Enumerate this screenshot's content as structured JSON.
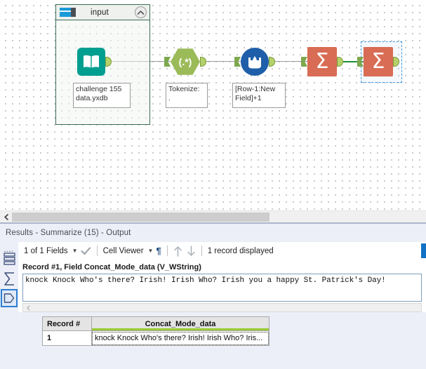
{
  "canvas": {
    "container": {
      "title": "input",
      "icon": "container-icon",
      "collapse_icon": "chevron-up-icon"
    },
    "tools": [
      {
        "name": "input-data-tool",
        "icon": "book-icon",
        "annotation": "challenge 155\ndata.yxdb",
        "annotation_line1": "challenge 155",
        "annotation_line2": "data.yxdb"
      },
      {
        "name": "regex-tool",
        "icon": "regex-icon",
        "glyph": "(.*)",
        "annotation_line1": "Tokenize:",
        "annotation_line2": "."
      },
      {
        "name": "multi-row-formula-tool",
        "icon": "beaker-drop-icon",
        "annotation_line1": "[Row-1:New",
        "annotation_line2": "Field]+1"
      },
      {
        "name": "summarize-tool-1",
        "icon": "sigma-icon",
        "glyph": "Σ"
      },
      {
        "name": "summarize-tool-2",
        "icon": "sigma-icon",
        "glyph": "Σ",
        "selected": true
      }
    ],
    "scrollbar": {
      "left_arrow": "chevron-left-icon"
    }
  },
  "results": {
    "title": "Results - Summarize (15) - Output",
    "rail": {
      "grip": "drag-grip-icon",
      "buttons": [
        {
          "name": "rail-messages-icon",
          "icon": "list-rows-icon"
        },
        {
          "name": "rail-summarize-icon",
          "icon": "sigma-icon"
        },
        {
          "name": "rail-cell-viewer-icon",
          "icon": "cell-tag-icon",
          "active": true
        }
      ]
    },
    "toolbar": {
      "fields_label": "1 of 1 Fields",
      "fields_caret": "chevron-down-icon",
      "check_icon": "checkmark-icon",
      "view_label": "Cell Viewer",
      "view_caret": "chevron-down-icon",
      "pilcrow_icon": "pilcrow-icon",
      "up_icon": "arrow-up-icon",
      "down_icon": "arrow-down-icon",
      "record_count": "1 record displayed"
    },
    "cell_viewer": {
      "header": "Record #1, Field Concat_Mode_data (V_WString)",
      "text": "knock Knock Who's there? Irish! Irish Who? Irish you a happy St. Patrick's Day!",
      "scroll_left_icon": "chevron-left-icon"
    },
    "grid": {
      "columns": [
        "Record #",
        "Concat_Mode_data"
      ],
      "rows": [
        [
          "1",
          "knock Knock Who's there? Irish! Irish Who? Iris..."
        ]
      ]
    }
  },
  "colors": {
    "input_tool": "#009e8f",
    "regex_tool": "#9bbb59",
    "multirow_tool": "#1f5fa9",
    "summarize_tool": "#d96c54",
    "selection": "#3d95e0",
    "string_type_bar": "#99cc33",
    "results_bg": "#eceff7"
  }
}
